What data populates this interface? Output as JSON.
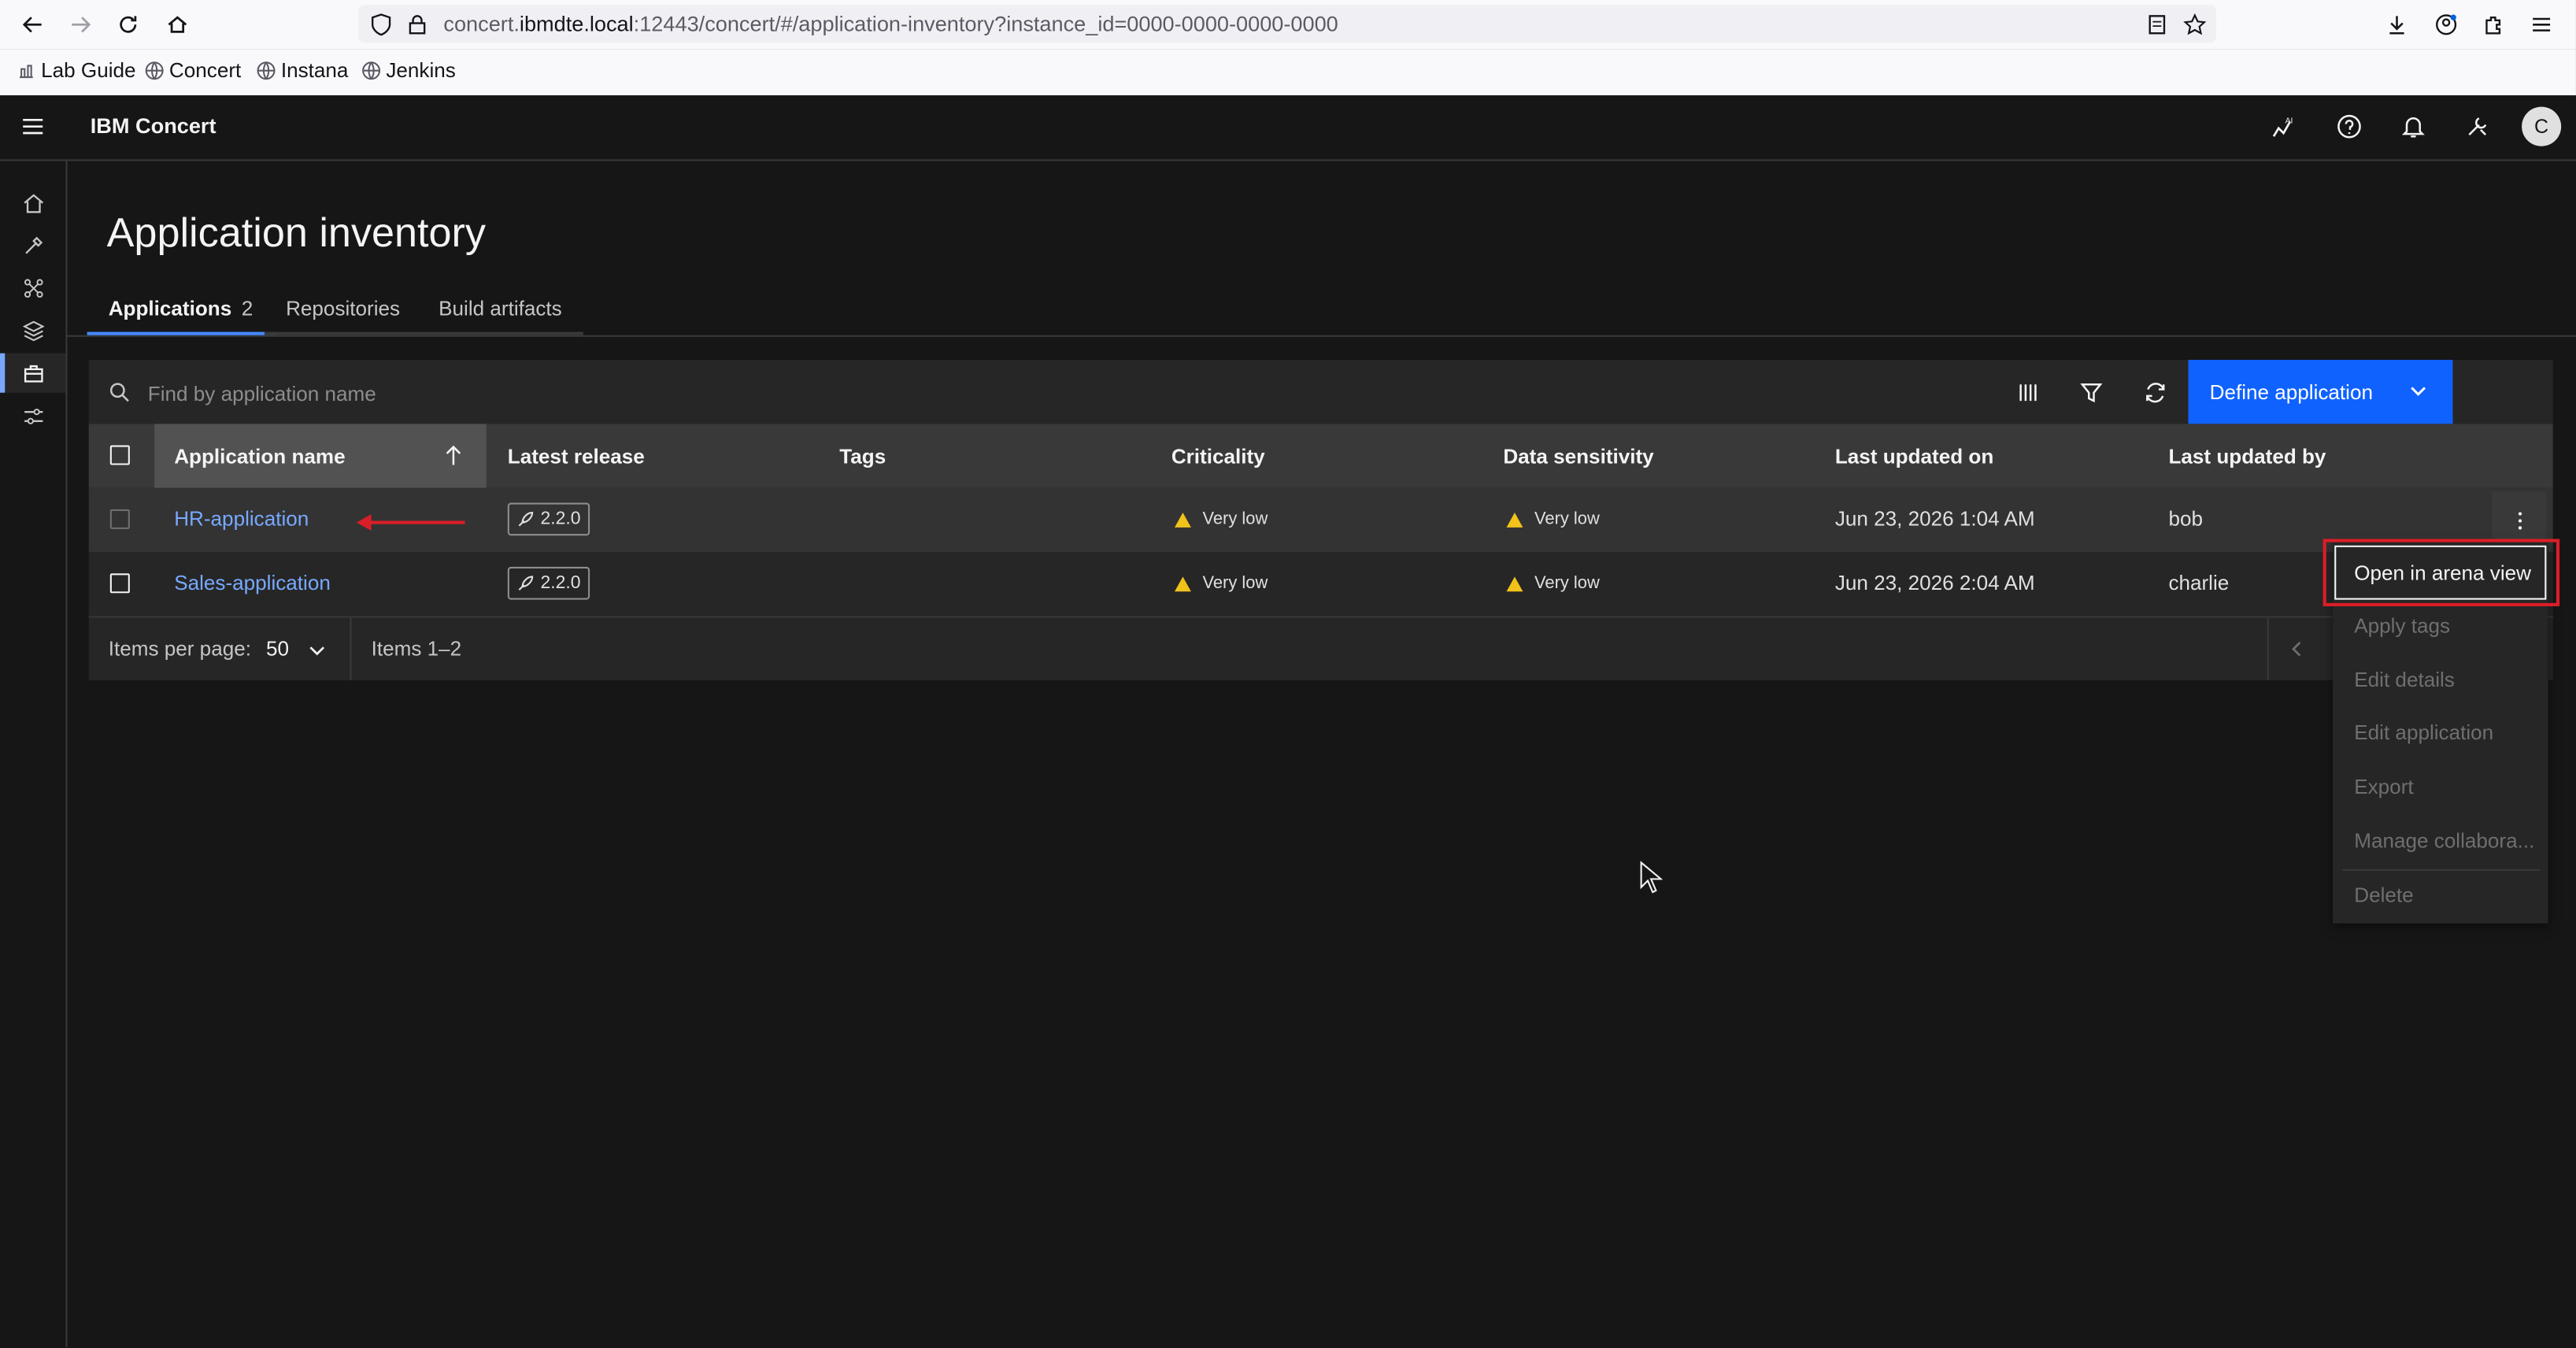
{
  "browser": {
    "url_prefix": "concert.",
    "url_host": "ibmdte.local",
    "url_rest": ":12443/concert/#/application-inventory?instance_id=0000-0000-0000-0000",
    "bookmarks": [
      "Lab Guide",
      "Concert",
      "Instana",
      "Jenkins"
    ]
  },
  "header": {
    "product_name": "IBM Concert",
    "avatar_initial": "C"
  },
  "page": {
    "title": "Application inventory",
    "tabs": [
      {
        "label": "Applications",
        "count": "2"
      },
      {
        "label": "Repositories"
      },
      {
        "label": "Build artifacts"
      }
    ]
  },
  "toolbar": {
    "search_placeholder": "Find by application name",
    "define_button": "Define application"
  },
  "table": {
    "columns": [
      "Application name",
      "Latest release",
      "Tags",
      "Criticality",
      "Data sensitivity",
      "Last updated on",
      "Last updated by"
    ],
    "rows": [
      {
        "name": "HR-application",
        "release": "2.2.0",
        "tags": "",
        "criticality": "Very low",
        "sensitivity": "Very low",
        "updated_on": "Jun 23, 2026 1:04 AM",
        "updated_by": "bob"
      },
      {
        "name": "Sales-application",
        "release": "2.2.0",
        "tags": "",
        "criticality": "Very low",
        "sensitivity": "Very low",
        "updated_on": "Jun 23, 2026 2:04 AM",
        "updated_by": "charlie"
      }
    ]
  },
  "pagination": {
    "items_per_page_label": "Items per page:",
    "items_per_page": "50",
    "range": "Items 1–2"
  },
  "overflow_menu": {
    "items": [
      "Open in arena view",
      "Apply tags",
      "Edit details",
      "Edit application",
      "Export",
      "Manage collabora...",
      "Delete"
    ]
  },
  "colors": {
    "accent": "#0f62fe",
    "link": "#78a9ff",
    "warning": "#f1c21b",
    "annotation": "#da1e28"
  }
}
